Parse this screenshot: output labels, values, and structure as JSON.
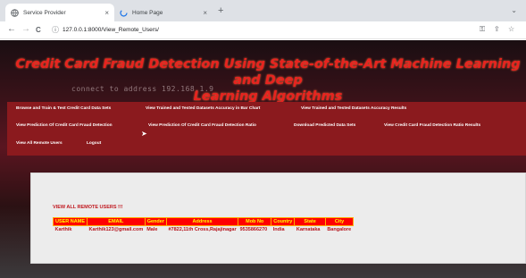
{
  "browser": {
    "tabs": [
      {
        "title": "Service Provider",
        "icon": "globe-icon"
      },
      {
        "title": "Home Page",
        "icon": "loading-icon"
      }
    ],
    "close_glyph": "×",
    "new_tab_glyph": "+",
    "url": "127.0.0.1:8000/View_Remote_Users/",
    "nav": {
      "back": "←",
      "forward": "→",
      "reload": "C"
    },
    "tools": {
      "key": "⚿",
      "share": "⇪",
      "star": "☆",
      "chevron": "⌄"
    }
  },
  "page": {
    "background_text": "connect to address 192.168.1.9",
    "title_line1": "Credit Card Fraud Detection Using State-of-the-Art Machine Learning and Deep",
    "title_line2": "Learning Algorithms",
    "menu": [
      "Browse and Train & Test Credit Card Data Sets",
      "View Trained and Tested Datasets Accuracy in Bar Chart",
      "View Trained and Tested Datasets Accuracy Results",
      "View Prediction Of Credit Card Fraud Detection",
      "View Prediction Of Credit Card Fraud Detection Ratio",
      "Download Predicted Data Sets",
      "View Credit Card Fraud Detection Ratio Results",
      "View All Remote Users",
      "Logout"
    ],
    "heading": "VIEW ALL REMOTE USERS !!!",
    "columns": [
      "USER NAME",
      "EMAIL",
      "Gender",
      "Address",
      "Mob No",
      "Country",
      "State",
      "City"
    ],
    "rows": [
      [
        "Karthik",
        "Karthik123@gmail.com",
        "Male",
        "#7822,11th Cross,Rajajinagar",
        "9535866270",
        "India",
        "Karnataka",
        "Bangalore"
      ]
    ]
  }
}
